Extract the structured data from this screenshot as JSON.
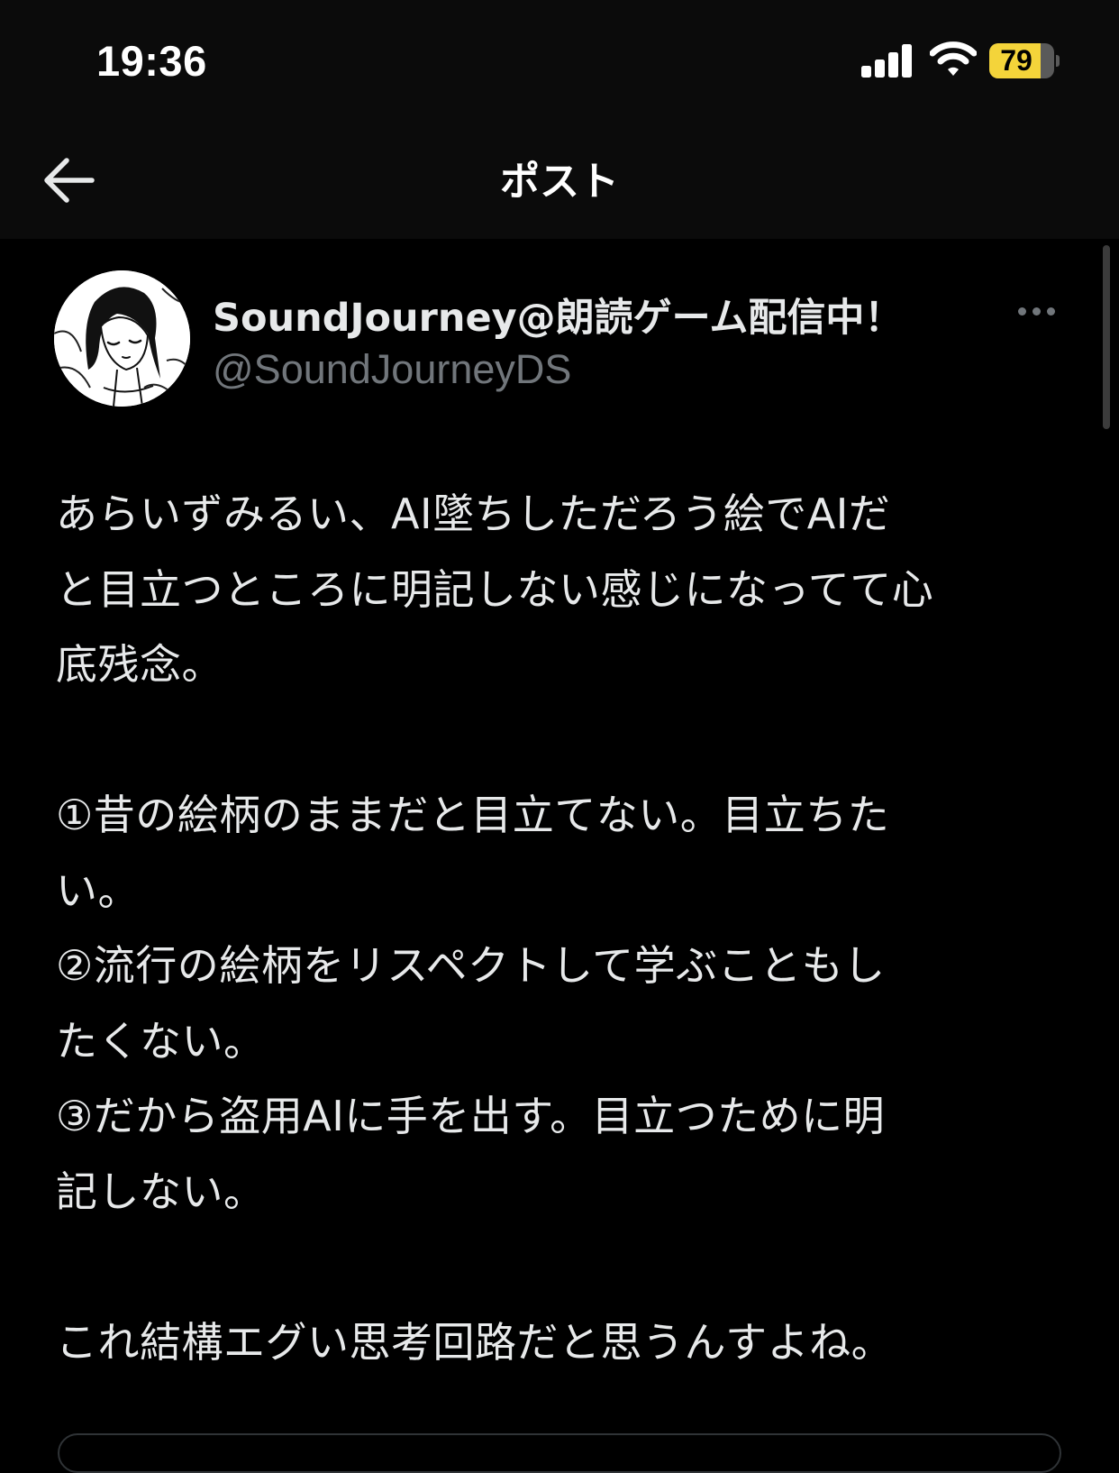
{
  "status_bar": {
    "time": "19:36",
    "battery_level": "79",
    "battery_fraction": 0.79
  },
  "header": {
    "title": "ポスト"
  },
  "post": {
    "author": {
      "display_name": "SoundJourney@朗読ゲーム配信中！",
      "handle": "@SoundJourneyDS"
    },
    "body_lines": [
      "あらいずみるい、AI墜ちしただろう絵でAIだ",
      "と目立つところに明記しない感じになってて心",
      "底残念。",
      "",
      "①昔の絵柄のままだと目立てない。目立ちた",
      "い。",
      "②流行の絵柄をリスペクトして学ぶこともし",
      "たくない。",
      "③だから盗用AIに手を出す。目立つために明",
      "記しない。",
      "",
      "これ結構エグい思考回路だと思うんすよね。"
    ]
  },
  "icons": {
    "back": "arrow-left-icon",
    "more": "more-horizontal-icon",
    "signal": "cellular-signal-icon",
    "wifi": "wifi-icon",
    "battery": "battery-icon"
  },
  "colors": {
    "background": "#000000",
    "header_background": "#0b0b0b",
    "primary_text": "#e7e9ea",
    "secondary_text": "#71767b",
    "battery_fill": "#f4d43a"
  }
}
